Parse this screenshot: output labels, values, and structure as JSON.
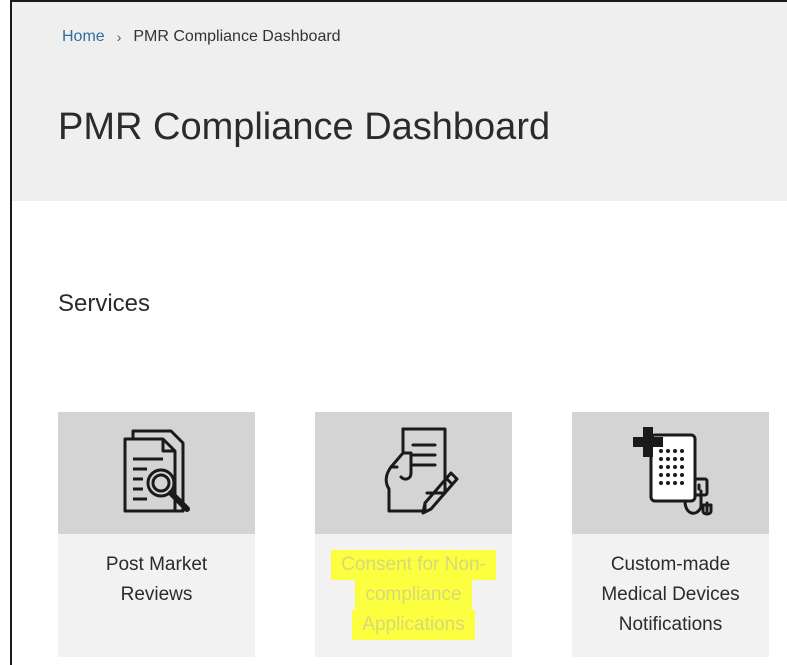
{
  "breadcrumb": {
    "home": "Home",
    "separator": "›",
    "current": "PMR Compliance Dashboard"
  },
  "page": {
    "title": "PMR Compliance Dashboard"
  },
  "services": {
    "heading": "Services",
    "tiles": [
      {
        "icon": "document-search-icon",
        "label_lines": [
          "Post Market",
          "Reviews"
        ]
      },
      {
        "icon": "hand-document-pen-icon",
        "label_lines": [
          "Consent for Non-",
          "compliance",
          "Applications"
        ],
        "highlight": "#fbff3f"
      },
      {
        "icon": "medical-device-plug-icon",
        "label_lines": [
          "Custom-made",
          "Medical Devices",
          "Notifications"
        ]
      }
    ]
  },
  "colors": {
    "header_bg": "#efefef",
    "icon_bg": "#d4d4d4",
    "tile_bg": "#f2f2f2",
    "link": "#2f6f9f",
    "highlight": "#fbff3f"
  }
}
